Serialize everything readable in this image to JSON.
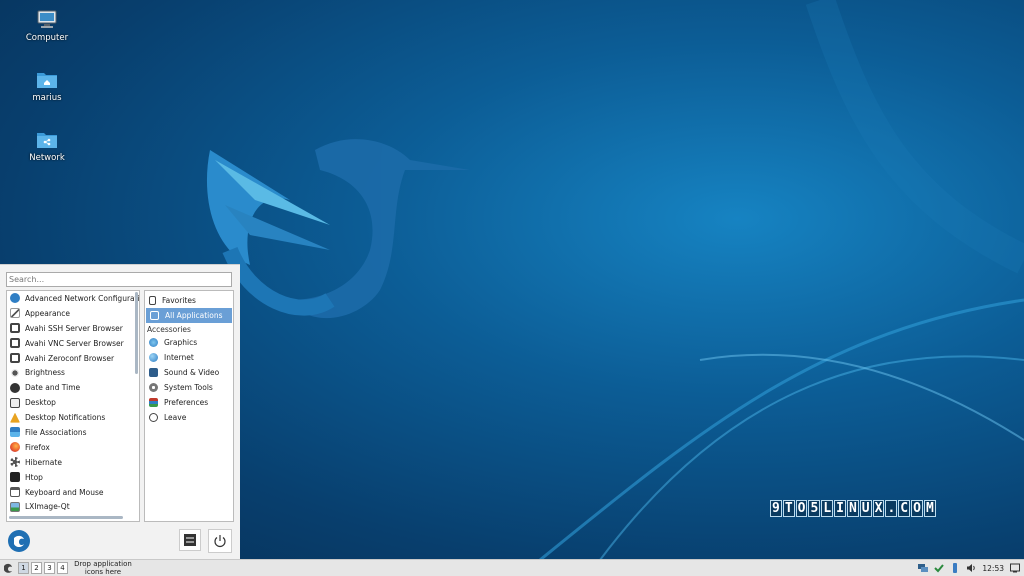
{
  "desktop": {
    "icons": [
      {
        "label": "Computer",
        "icon": "computer-icon"
      },
      {
        "label": "marius",
        "icon": "home-folder-icon"
      },
      {
        "label": "Network",
        "icon": "network-folder-icon"
      }
    ],
    "watermark": [
      "9",
      "T",
      "O",
      "5",
      "L",
      "I",
      "N",
      "U",
      "X",
      ".",
      "C",
      "O",
      "M"
    ]
  },
  "menu": {
    "search_placeholder": "Search...",
    "apps": [
      {
        "label": "Advanced Network Configuration",
        "icon": "network-config-icon",
        "color": "#2f7ec4"
      },
      {
        "label": "Appearance",
        "icon": "brush-icon",
        "color": "#555555"
      },
      {
        "label": "Avahi SSH Server Browser",
        "icon": "monitor-icon",
        "color": "#444444"
      },
      {
        "label": "Avahi VNC Server Browser",
        "icon": "monitor-icon",
        "color": "#444444"
      },
      {
        "label": "Avahi Zeroconf Browser",
        "icon": "monitor-icon",
        "color": "#444444"
      },
      {
        "label": "Brightness",
        "icon": "brightness-icon",
        "color": "#555555"
      },
      {
        "label": "Date and Time",
        "icon": "clock-icon",
        "color": "#333333"
      },
      {
        "label": "Desktop",
        "icon": "desktop-icon",
        "color": "#444444"
      },
      {
        "label": "Desktop Notifications",
        "icon": "notification-bell-icon",
        "color": "#e8a321"
      },
      {
        "label": "File Associations",
        "icon": "file-associations-icon",
        "color": "#2f7ec4"
      },
      {
        "label": "Firefox",
        "icon": "firefox-icon",
        "color": "#e8532a"
      },
      {
        "label": "Hibernate",
        "icon": "hibernate-icon",
        "color": "#555555"
      },
      {
        "label": "Htop",
        "icon": "terminal-icon",
        "color": "#222222"
      },
      {
        "label": "Keyboard and Mouse",
        "icon": "keyboard-icon",
        "color": "#555555"
      },
      {
        "label": "LXImage-Qt",
        "icon": "image-viewer-icon",
        "color": "#3a9a4a"
      }
    ],
    "categories_top": [
      {
        "label": "Favorites",
        "icon": "favorites-icon",
        "selected": false
      },
      {
        "label": "All Applications",
        "icon": "all-apps-icon",
        "selected": true
      }
    ],
    "section_header": "Accessories",
    "categories": [
      {
        "label": "Graphics",
        "icon": "graphics-icon",
        "color": "#2f7ec4"
      },
      {
        "label": "Internet",
        "icon": "internet-globe-icon",
        "color": "#2f7ec4"
      },
      {
        "label": "Sound & Video",
        "icon": "multimedia-icon",
        "color": "#2d5c8a"
      },
      {
        "label": "System Tools",
        "icon": "gear-icon",
        "color": "#777777"
      },
      {
        "label": "Preferences",
        "icon": "preferences-icon",
        "color": "#c0392b"
      },
      {
        "label": "Leave",
        "icon": "power-icon",
        "color": "#444444"
      }
    ]
  },
  "taskbar": {
    "workspaces": [
      "1",
      "2",
      "3",
      "4"
    ],
    "drop_text": "Drop application icons here",
    "clock": "12:53",
    "tray_icons": [
      "network-tray-icon",
      "update-tray-icon",
      "usb-tray-icon",
      "volume-icon",
      "show-desktop-icon"
    ]
  },
  "colors": {
    "accent": "#6a9fd6",
    "wallpaper_dark": "#062d52",
    "wallpaper_light": "#1683c2"
  }
}
